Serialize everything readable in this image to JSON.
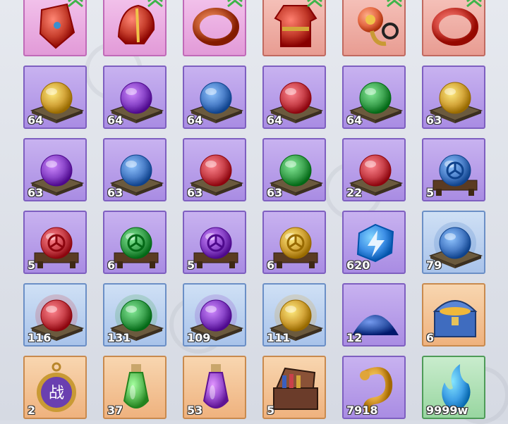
{
  "inventory": {
    "slots": [
      {
        "id": "s0",
        "rarity": "pink",
        "icon": "armor-piece-icon",
        "color": "#c8402e",
        "count": "",
        "upgrade": true
      },
      {
        "id": "s1",
        "rarity": "pink",
        "icon": "helmet-icon",
        "color": "#c8402e",
        "count": "",
        "upgrade": true
      },
      {
        "id": "s2",
        "rarity": "pink",
        "icon": "ring-icon",
        "color": "#c0572c",
        "count": "",
        "upgrade": true
      },
      {
        "id": "s3",
        "rarity": "red",
        "icon": "robe-icon",
        "color": "#c33a2a",
        "count": "",
        "upgrade": true
      },
      {
        "id": "s4",
        "rarity": "red",
        "icon": "belt-icon",
        "color": "#e56a45",
        "count": "",
        "upgrade": true
      },
      {
        "id": "s5",
        "rarity": "red",
        "icon": "bracelet-icon",
        "color": "#d2453c",
        "count": "",
        "upgrade": true
      },
      {
        "id": "s6",
        "rarity": "purple",
        "icon": "orb-gold-icon",
        "color": "#d4a63a",
        "count": "64"
      },
      {
        "id": "s7",
        "rarity": "purple",
        "icon": "orb-purple-icon",
        "color": "#8a45c9",
        "count": "64"
      },
      {
        "id": "s8",
        "rarity": "purple",
        "icon": "orb-blue-icon",
        "color": "#4b7fc9",
        "count": "64"
      },
      {
        "id": "s9",
        "rarity": "purple",
        "icon": "orb-red-icon",
        "color": "#c9414a",
        "count": "64"
      },
      {
        "id": "s10",
        "rarity": "purple",
        "icon": "orb-green-icon",
        "color": "#3fa552",
        "count": "64"
      },
      {
        "id": "s11",
        "rarity": "purple",
        "icon": "orb-gold-icon",
        "color": "#d4a63a",
        "count": "63"
      },
      {
        "id": "s12",
        "rarity": "purple",
        "icon": "orb-purple-icon",
        "color": "#8a45c9",
        "count": "63"
      },
      {
        "id": "s13",
        "rarity": "purple",
        "icon": "orb-blue-icon",
        "color": "#4b7fc9",
        "count": "63"
      },
      {
        "id": "s14",
        "rarity": "purple",
        "icon": "orb-red-icon",
        "color": "#c9414a",
        "count": "63"
      },
      {
        "id": "s15",
        "rarity": "purple",
        "icon": "orb-green-icon",
        "color": "#3fa552",
        "count": "63"
      },
      {
        "id": "s16",
        "rarity": "purple",
        "icon": "orb-red-icon",
        "color": "#c9414a",
        "count": "22"
      },
      {
        "id": "s17",
        "rarity": "purple",
        "icon": "rune-orb-blue-icon",
        "color": "#4b7fc9",
        "count": "5",
        "rune": true
      },
      {
        "id": "s18",
        "rarity": "purple",
        "icon": "rune-orb-red-icon",
        "color": "#c9414a",
        "count": "5",
        "rune": true
      },
      {
        "id": "s19",
        "rarity": "purple",
        "icon": "rune-orb-green-icon",
        "color": "#3fa552",
        "count": "6",
        "rune": true
      },
      {
        "id": "s20",
        "rarity": "purple",
        "icon": "rune-orb-purple-icon",
        "color": "#8a45c9",
        "count": "5",
        "rune": true
      },
      {
        "id": "s21",
        "rarity": "purple",
        "icon": "rune-orb-gold-icon",
        "color": "#d4a63a",
        "count": "6",
        "rune": true
      },
      {
        "id": "s22",
        "rarity": "purple",
        "icon": "lightning-crystal-icon",
        "color": "#3d8fe6",
        "count": "620"
      },
      {
        "id": "s23",
        "rarity": "blue",
        "icon": "orb-blue-icon",
        "color": "#4b7fc9",
        "count": "79",
        "glow": true
      },
      {
        "id": "s24",
        "rarity": "blue",
        "icon": "orb-red-icon",
        "color": "#c9414a",
        "count": "116",
        "glow": true
      },
      {
        "id": "s25",
        "rarity": "blue",
        "icon": "orb-green-icon",
        "color": "#3fa552",
        "count": "131",
        "glow": true
      },
      {
        "id": "s26",
        "rarity": "blue",
        "icon": "orb-purple-icon",
        "color": "#8a45c9",
        "count": "109",
        "glow": true
      },
      {
        "id": "s27",
        "rarity": "blue",
        "icon": "orb-gold-icon",
        "color": "#d4a63a",
        "count": "111",
        "glow": true
      },
      {
        "id": "s28",
        "rarity": "purple",
        "icon": "sand-pile-icon",
        "color": "#2f54a8",
        "count": "12"
      },
      {
        "id": "s29",
        "rarity": "orange",
        "icon": "treasure-chest-icon",
        "color": "#3f6cbf",
        "count": "6"
      },
      {
        "id": "s30",
        "rarity": "orange",
        "icon": "battle-token-icon",
        "color": "#6a3fb0",
        "count": "2",
        "token": "战"
      },
      {
        "id": "s31",
        "rarity": "orange",
        "icon": "green-potion-icon",
        "color": "#5fbf5a",
        "count": "37"
      },
      {
        "id": "s32",
        "rarity": "orange",
        "icon": "purple-potion-icon",
        "color": "#9b4fd0",
        "count": "53"
      },
      {
        "id": "s33",
        "rarity": "orange",
        "icon": "jewel-box-icon",
        "color": "#6b3c2a",
        "count": "5"
      },
      {
        "id": "s34",
        "rarity": "purple",
        "icon": "golden-hook-icon",
        "color": "#e0a53a",
        "count": "7918"
      },
      {
        "id": "s35",
        "rarity": "green",
        "icon": "blue-flame-icon",
        "color": "#3fa0e6",
        "count": "9999w"
      }
    ]
  }
}
